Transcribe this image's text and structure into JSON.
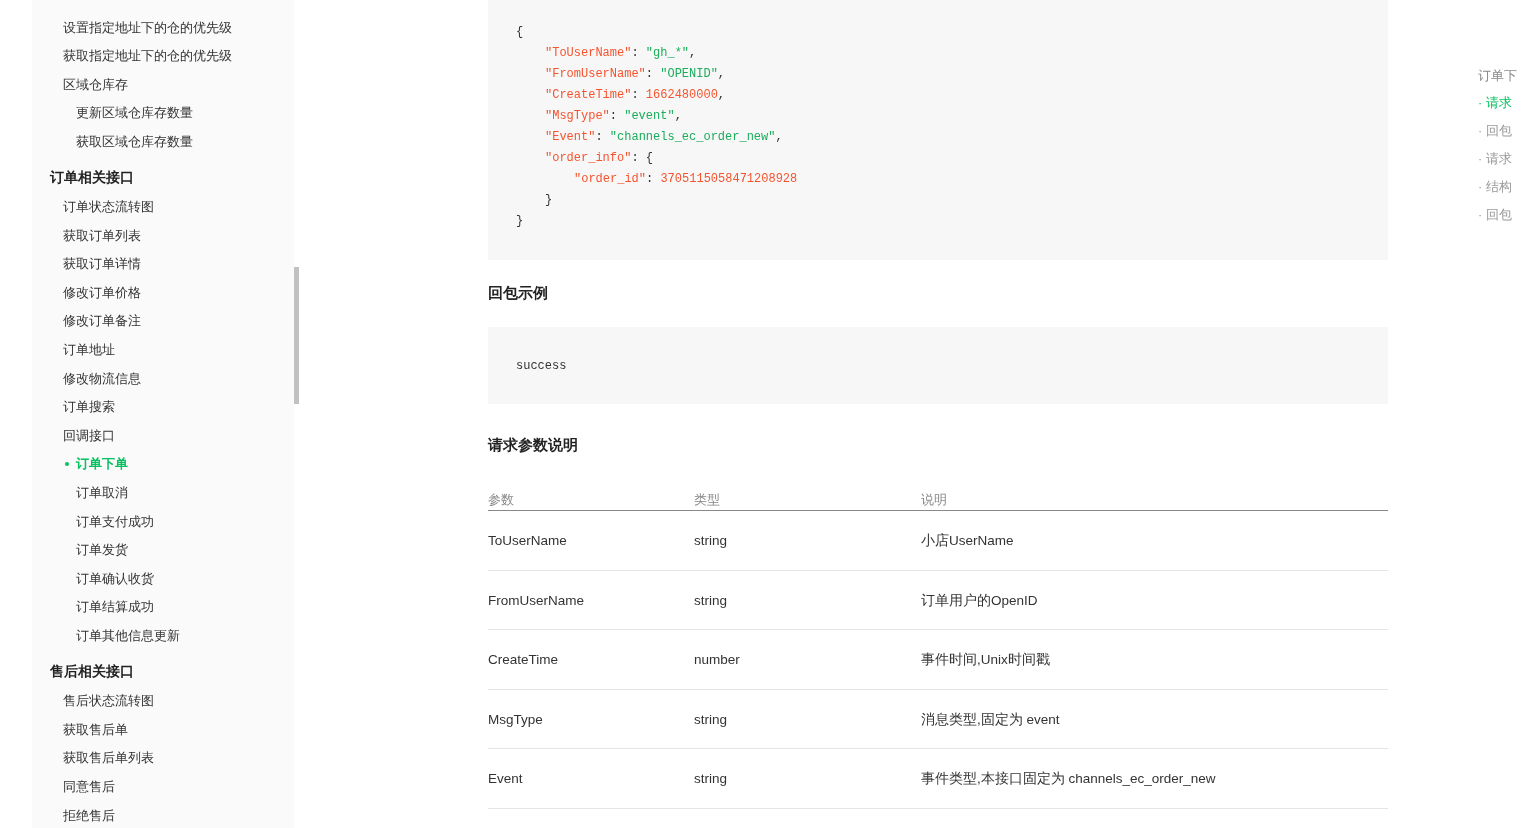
{
  "sidebar": {
    "items": [
      {
        "kind": "item",
        "label": "设置指定地址下的仓的优先级",
        "selected": false
      },
      {
        "kind": "item",
        "label": "获取指定地址下的仓的优先级",
        "selected": false
      },
      {
        "kind": "item",
        "label": "区域仓库存",
        "selected": false
      },
      {
        "kind": "sub",
        "label": "更新区域仓库存数量",
        "selected": false
      },
      {
        "kind": "sub",
        "label": "获取区域仓库存数量",
        "selected": false
      },
      {
        "kind": "section",
        "label": "订单相关接口"
      },
      {
        "kind": "item",
        "label": "订单状态流转图",
        "selected": false
      },
      {
        "kind": "item",
        "label": "获取订单列表",
        "selected": false
      },
      {
        "kind": "item",
        "label": "获取订单详情",
        "selected": false
      },
      {
        "kind": "item",
        "label": "修改订单价格",
        "selected": false
      },
      {
        "kind": "item",
        "label": "修改订单备注",
        "selected": false
      },
      {
        "kind": "item",
        "label": "订单地址",
        "selected": false
      },
      {
        "kind": "item",
        "label": "修改物流信息",
        "selected": false
      },
      {
        "kind": "item",
        "label": "订单搜索",
        "selected": false
      },
      {
        "kind": "item",
        "label": "回调接口",
        "selected": false
      },
      {
        "kind": "sub",
        "label": "订单下单",
        "selected": true
      },
      {
        "kind": "sub",
        "label": "订单取消",
        "selected": false
      },
      {
        "kind": "sub",
        "label": "订单支付成功",
        "selected": false
      },
      {
        "kind": "sub",
        "label": "订单发货",
        "selected": false
      },
      {
        "kind": "sub",
        "label": "订单确认收货",
        "selected": false
      },
      {
        "kind": "sub",
        "label": "订单结算成功",
        "selected": false
      },
      {
        "kind": "sub",
        "label": "订单其他信息更新",
        "selected": false
      },
      {
        "kind": "section",
        "label": "售后相关接口"
      },
      {
        "kind": "item",
        "label": "售后状态流转图",
        "selected": false
      },
      {
        "kind": "item",
        "label": "获取售后单",
        "selected": false
      },
      {
        "kind": "item",
        "label": "获取售后单列表",
        "selected": false
      },
      {
        "kind": "item",
        "label": "同意售后",
        "selected": false
      },
      {
        "kind": "item",
        "label": "拒绝售后",
        "selected": false
      }
    ]
  },
  "request_example": {
    "lines": [
      {
        "tokens": [
          {
            "kind": "punct",
            "text": "{"
          }
        ],
        "children": [
          {
            "tokens": [
              {
                "kind": "key",
                "text": "\"ToUserName\""
              },
              {
                "kind": "punct",
                "text": ": "
              },
              {
                "kind": "string",
                "text": "\"gh_*\""
              },
              {
                "kind": "punct",
                "text": ","
              }
            ]
          },
          {
            "tokens": [
              {
                "kind": "key",
                "text": "\"FromUserName\""
              },
              {
                "kind": "punct",
                "text": ": "
              },
              {
                "kind": "string",
                "text": "\"OPENID\""
              },
              {
                "kind": "punct",
                "text": ","
              }
            ]
          },
          {
            "tokens": [
              {
                "kind": "key",
                "text": "\"CreateTime\""
              },
              {
                "kind": "punct",
                "text": ": "
              },
              {
                "kind": "number",
                "text": "1662480000"
              },
              {
                "kind": "punct",
                "text": ","
              }
            ]
          },
          {
            "tokens": [
              {
                "kind": "key",
                "text": "\"MsgType\""
              },
              {
                "kind": "punct",
                "text": ": "
              },
              {
                "kind": "string",
                "text": "\"event\""
              },
              {
                "kind": "punct",
                "text": ","
              }
            ]
          },
          {
            "tokens": [
              {
                "kind": "key",
                "text": "\"Event\""
              },
              {
                "kind": "punct",
                "text": ": "
              },
              {
                "kind": "string",
                "text": "\"channels_ec_order_new\""
              },
              {
                "kind": "punct",
                "text": ","
              }
            ]
          },
          {
            "tokens": [
              {
                "kind": "key",
                "text": "\"order_info\""
              },
              {
                "kind": "punct",
                "text": ": {"
              }
            ],
            "children": [
              {
                "tokens": [
                  {
                    "kind": "key",
                    "text": "\"order_id\""
                  },
                  {
                    "kind": "punct",
                    "text": ": "
                  },
                  {
                    "kind": "number",
                    "text": "3705115058471208928"
                  }
                ]
              }
            ]
          },
          {
            "tokens": [
              {
                "kind": "punct",
                "text": "}"
              }
            ]
          }
        ]
      },
      {
        "tokens": [
          {
            "kind": "punct",
            "text": "}"
          }
        ]
      }
    ]
  },
  "response_example": {
    "heading": "回包示例",
    "code": "success"
  },
  "request_params": {
    "heading": "请求参数说明",
    "columns": [
      "参数",
      "类型",
      "说明"
    ],
    "rows": [
      [
        "ToUserName",
        "string",
        "小店UserName"
      ],
      [
        "FromUserName",
        "string",
        "订单用户的OpenID"
      ],
      [
        "CreateTime",
        "number",
        "事件时间,Unix时间戳"
      ],
      [
        "MsgType",
        "string",
        "消息类型,固定为 event"
      ],
      [
        "Event",
        "string",
        "事件类型,本接口固定为 channels_ec_order_new"
      ]
    ]
  },
  "toc": {
    "items": [
      {
        "kind": "title",
        "label": "订单下",
        "selected": false
      },
      {
        "kind": "entry",
        "label": "· 请求",
        "selected": true
      },
      {
        "kind": "entry",
        "label": "· 回包",
        "selected": false
      },
      {
        "kind": "entry",
        "label": "· 请求",
        "selected": false
      },
      {
        "kind": "entry",
        "label": "· 结构",
        "selected": false
      },
      {
        "kind": "entry",
        "label": "· 回包",
        "selected": false
      }
    ]
  }
}
